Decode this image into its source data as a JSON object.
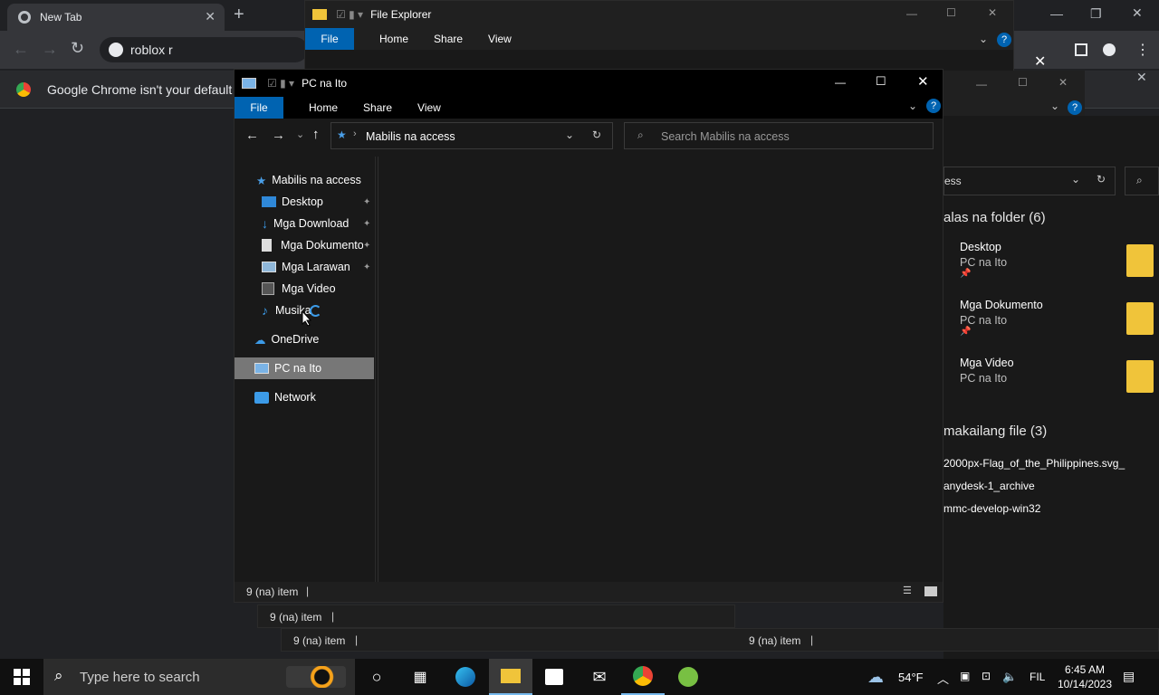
{
  "chrome": {
    "tab_title": "New Tab",
    "omnibox_text": "roblox r",
    "infobar_text": "Google Chrome isn't your default br"
  },
  "explorer_back": {
    "title": "File Explorer",
    "ribbon": [
      "File",
      "Home",
      "Share",
      "View"
    ],
    "address": "Mabilis na access",
    "search_placeholder": "Search Mabilis na access",
    "address_partial": "ess",
    "section_folders": "alas na folder (6)",
    "folders": [
      {
        "name": "Desktop",
        "location": "PC na Ito"
      },
      {
        "name": "Mga Dokumento",
        "location": "PC na Ito"
      },
      {
        "name": "Mga Video",
        "location": "PC na Ito"
      }
    ],
    "section_files": "makailang file (3)",
    "files": [
      "2000px-Flag_of_the_Philippines.svg_",
      "anydesk-1_archive",
      "mmc-develop-win32"
    ],
    "status_mid": "9 (na) item",
    "status_left": "9 (na) item",
    "status_right": "9 (na) item"
  },
  "explorer_front": {
    "title": "PC na Ito",
    "ribbon": {
      "file": "File",
      "home": "Home",
      "share": "Share",
      "view": "View"
    },
    "address": "Mabilis na access",
    "search_placeholder": "Search Mabilis na access",
    "nav": {
      "quick_access": "Mabilis na access",
      "items": [
        "Desktop",
        "Mga Download",
        "Mga Dokumento",
        "Mga Larawan",
        "Mga Video",
        "Musika"
      ],
      "onedrive": "OneDrive",
      "this_pc": "PC na Ito",
      "network": "Network"
    },
    "status": "9 (na) item"
  },
  "taskbar": {
    "search_placeholder": "Type here to search",
    "weather": "54°F",
    "language": "FIL",
    "time": "6:45 AM",
    "date": "10/14/2023"
  },
  "colors": {
    "accent": "#0063b1",
    "selected": "#777777",
    "folder": "#f0c43a"
  }
}
